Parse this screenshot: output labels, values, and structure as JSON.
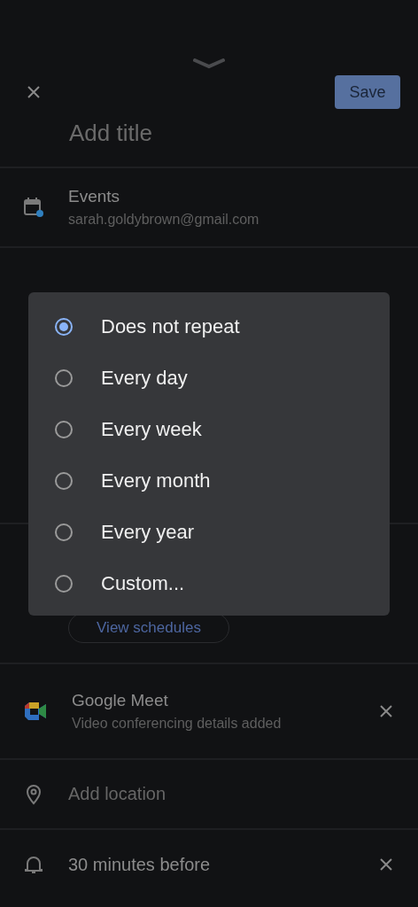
{
  "header": {
    "save_button": "Save"
  },
  "title_field": {
    "placeholder": "Add title"
  },
  "calendar": {
    "name": "Events",
    "account": "sarah.goldybrown@gmail.com"
  },
  "schedules_button": "View schedules",
  "conferencing": {
    "name": "Google Meet",
    "detail": "Video conferencing details added"
  },
  "location": {
    "placeholder": "Add location"
  },
  "notification": {
    "text": "30 minutes before"
  },
  "repeat_menu": {
    "options": [
      {
        "label": "Does not repeat",
        "selected": true
      },
      {
        "label": "Every day",
        "selected": false
      },
      {
        "label": "Every week",
        "selected": false
      },
      {
        "label": "Every month",
        "selected": false
      },
      {
        "label": "Every year",
        "selected": false
      },
      {
        "label": "Custom...",
        "selected": false
      }
    ]
  }
}
